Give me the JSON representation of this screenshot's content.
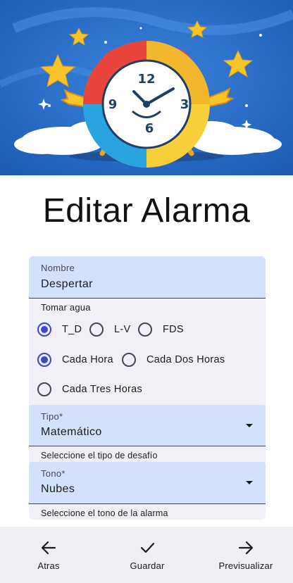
{
  "page": {
    "title": "Editar Alarma"
  },
  "form": {
    "nombre": {
      "label": "Nombre",
      "value": "Despertar"
    },
    "group_label": "Tomar agua",
    "days": [
      {
        "label": "T_D",
        "checked": true
      },
      {
        "label": "L-V",
        "checked": false
      },
      {
        "label": "FDS",
        "checked": false
      }
    ],
    "frequency": [
      {
        "label": "Cada Hora",
        "checked": true
      },
      {
        "label": "Cada Dos Horas",
        "checked": false
      },
      {
        "label": "Cada Tres Horas",
        "checked": false
      }
    ],
    "tipo": {
      "label": "Tipo*",
      "value": "Matemático",
      "helper": "Seleccione el tipo de desafío"
    },
    "tono": {
      "label": "Tono*",
      "value": "Nubes",
      "helper": "Seleccione el tono de la alarma"
    }
  },
  "bottom_nav": {
    "back": {
      "label": "Atras",
      "icon": "arrow-left-icon"
    },
    "save": {
      "label": "Guardar",
      "icon": "check-icon"
    },
    "preview": {
      "label": "Previsualizar",
      "icon": "arrow-right-icon"
    }
  },
  "colors": {
    "accent": "#3b46d6",
    "field_fill": "#d4e1fb",
    "card_bg": "#f1f0f7",
    "banner_bg": "#2b6cc8"
  }
}
